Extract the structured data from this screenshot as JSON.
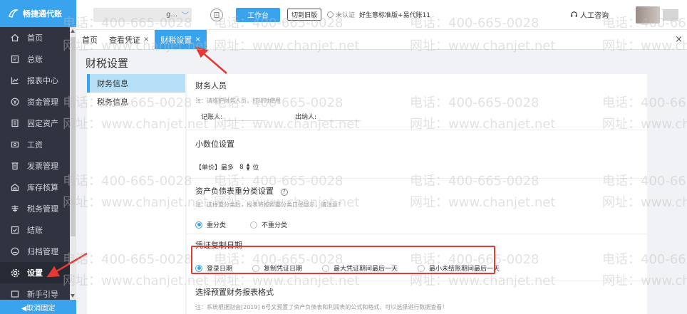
{
  "sidebar": {
    "logo_text": "畅捷通代账",
    "items": [
      {
        "label": "首页",
        "icon": "home-icon"
      },
      {
        "label": "总账",
        "icon": "ledger-icon"
      },
      {
        "label": "报表中心",
        "icon": "chart-icon"
      },
      {
        "label": "资金管理",
        "icon": "fund-icon"
      },
      {
        "label": "固定资产",
        "icon": "asset-icon"
      },
      {
        "label": "工资",
        "icon": "salary-icon"
      },
      {
        "label": "发票管理",
        "icon": "invoice-icon"
      },
      {
        "label": "库存核算",
        "icon": "inventory-icon"
      },
      {
        "label": "税务管理",
        "icon": "tax-icon"
      },
      {
        "label": "结账",
        "icon": "checkout-icon"
      },
      {
        "label": "归档管理",
        "icon": "archive-icon"
      },
      {
        "label": "设置",
        "icon": "gear-icon"
      },
      {
        "label": "新手引导",
        "icon": "guide-icon"
      }
    ],
    "active_index": 11,
    "unpin_label": "◀取消固定"
  },
  "topbar": {
    "account_suffix": "g...",
    "workbench_label": "工作台",
    "old_version_label": "切到旧版",
    "auth_status": "未认证",
    "account_name": "好生意标准版+易代账11",
    "support_label": "人工咨询"
  },
  "tabs": [
    {
      "label": "首页",
      "closable": false
    },
    {
      "label": "查看凭证",
      "closable": true
    },
    {
      "label": "财税设置",
      "closable": true
    }
  ],
  "tabs_close_all": "×",
  "page": {
    "title": "财税设置",
    "subnav": [
      "财务信息",
      "税务信息"
    ],
    "sections": {
      "finance_staff": {
        "title": "财务人员",
        "note": "注：请维护财务人员，打印时使用",
        "bookkeeper_label": "记账人:",
        "cashier_label": "出纳人:"
      },
      "decimal": {
        "title": "小数位设置",
        "unit_label": "【单价】最多",
        "value": "8",
        "suffix": "位"
      },
      "balance_sheet": {
        "title": "资产负债表重分类设置",
        "note": "注：选择重分类后，报表将按照重分类口径显示，请注意！",
        "options": [
          "重分类",
          "不重分类"
        ],
        "selected": 0
      },
      "voucher_copy_date": {
        "title": "凭证复制日期",
        "options": [
          "登录日期",
          "复制凭证日期",
          "最大凭证期间最后一天",
          "最小未结账期间最后一天"
        ],
        "selected": 0
      },
      "report_format": {
        "title": "选择预置财务报表格式",
        "note": "注：系统根据财会[2019] 6号文预置了资产负债表和利润表的公式和格式，可以选择进行数据查看！"
      }
    }
  },
  "watermark": {
    "phone": "电话：400-665-0028",
    "site": "网址：www.chanjet.net"
  },
  "colors": {
    "accent": "#3aa3ed",
    "sidebar_bg": "#2f3440",
    "annotation_red": "#e53935"
  }
}
